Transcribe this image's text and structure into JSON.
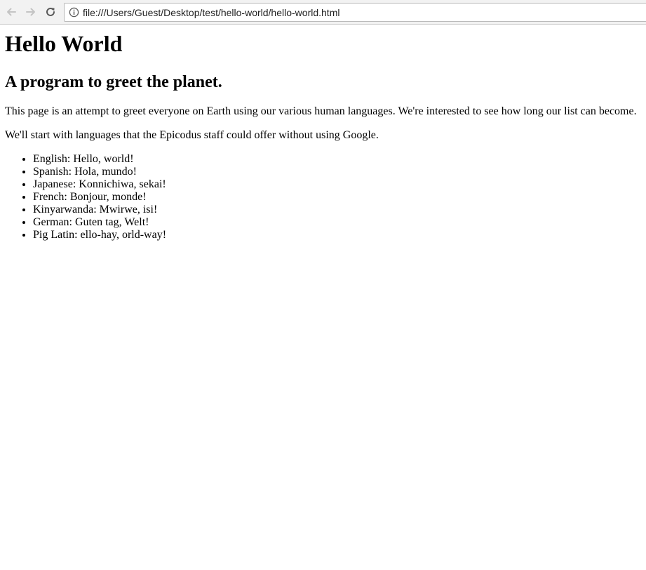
{
  "browser": {
    "url": "file:///Users/Guest/Desktop/test/hello-world/hello-world.html",
    "icons": {
      "back": "arrow-left-icon",
      "forward": "arrow-right-icon",
      "reload": "reload-icon",
      "info": "info-icon"
    }
  },
  "page": {
    "title": "Hello World",
    "subtitle": "A program to greet the planet.",
    "paragraphs": [
      "This page is an attempt to greet everyone on Earth using our various human languages. We're interested to see how long our list can become.",
      "We'll start with languages that the Epicodus staff could offer without using Google."
    ],
    "languages": [
      "English: Hello, world!",
      "Spanish: Hola, mundo!",
      "Japanese: Konnichiwa, sekai!",
      "French: Bonjour, monde!",
      "Kinyarwanda: Mwirwe, isi!",
      "German: Guten tag, Welt!",
      "Pig Latin: ello-hay, orld-way!"
    ]
  },
  "colors": {
    "toolbar_bg": "#f2f2f2",
    "toolbar_border": "#c8c8c8",
    "disabled_icon": "#c4c4c4",
    "active_icon": "#5a5a5a",
    "text": "#000000"
  }
}
